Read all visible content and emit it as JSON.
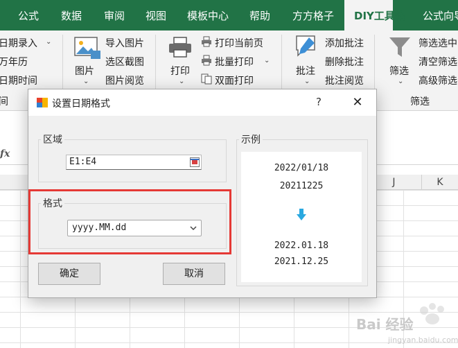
{
  "ribbon_tabs": [
    {
      "label": "公式"
    },
    {
      "label": "数据"
    },
    {
      "label": "审阅"
    },
    {
      "label": "视图"
    },
    {
      "label": "模板中心"
    },
    {
      "label": "帮助"
    },
    {
      "label": "方方格子"
    },
    {
      "label": "DIY工具箱",
      "active": true
    },
    {
      "label": "公式向导"
    }
  ],
  "ribbon": {
    "left_items": [
      "日期录入",
      "万年历",
      "日期时间",
      "间"
    ],
    "picture_group": {
      "big_label": "图片",
      "items": [
        "导入图片",
        "选区截图",
        "图片阅览"
      ]
    },
    "print_group": {
      "big_label": "打印",
      "items": [
        "打印当前页",
        "批量打印",
        "双面打印"
      ]
    },
    "comment_group": {
      "big_label": "批注",
      "items": [
        "添加批注",
        "删除批注",
        "批注阅览"
      ]
    },
    "filter_group": {
      "big_label": "筛选",
      "items": [
        "筛选选中",
        "清空筛选",
        "高级筛选"
      ],
      "group_title": "筛选"
    }
  },
  "sheet": {
    "fx_label": "fx",
    "columns": [
      "J",
      "K"
    ]
  },
  "dialog": {
    "title": "设置日期格式",
    "help": "?",
    "close": "✕",
    "range_group_label": "区域",
    "range_value": "E1:E4",
    "format_group_label": "格式",
    "format_value": "yyyy.MM.dd",
    "sample_group_label": "示例",
    "samples_before": [
      "2022/01/18",
      "20211225"
    ],
    "samples_after": [
      "2022.01.18",
      "2021.12.25"
    ],
    "ok_label": "确定",
    "cancel_label": "取消"
  },
  "watermark": {
    "text": "Bai 经验",
    "sub": "jingyan.baidu.com"
  },
  "colors": {
    "excel_green": "#217346",
    "highlight_red": "#e53935",
    "arrow_blue": "#29a8e0"
  }
}
